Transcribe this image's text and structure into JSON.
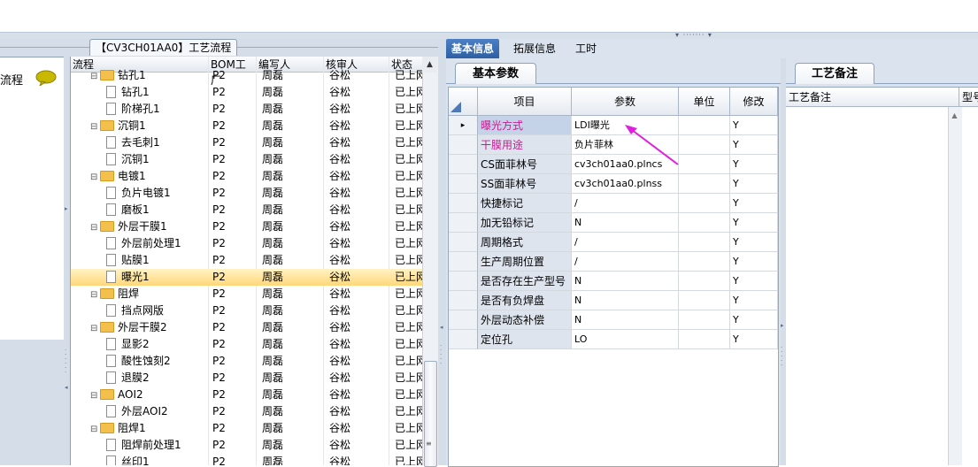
{
  "left_panel": {
    "flow_tab_label": "【CV3CH01AA0】工艺流程",
    "nav_label": "流程",
    "tree_headers": [
      "流程",
      "BOM工厂",
      "编写人",
      "核审人",
      "状态"
    ],
    "tree_rows": [
      {
        "level": 0,
        "kind": "folder",
        "name": "钻孔1",
        "bom": "P2",
        "author": "周磊",
        "reviewer": "谷松",
        "status": "已上网"
      },
      {
        "level": 1,
        "kind": "doc",
        "name": "钻孔1",
        "bom": "P2",
        "author": "周磊",
        "reviewer": "谷松",
        "status": "已上网"
      },
      {
        "level": 1,
        "kind": "doc",
        "name": "阶梯孔1",
        "bom": "P2",
        "author": "周磊",
        "reviewer": "谷松",
        "status": "已上网"
      },
      {
        "level": 0,
        "kind": "folder",
        "name": "沉铜1",
        "bom": "P2",
        "author": "周磊",
        "reviewer": "谷松",
        "status": "已上网"
      },
      {
        "level": 1,
        "kind": "doc",
        "name": "去毛刺1",
        "bom": "P2",
        "author": "周磊",
        "reviewer": "谷松",
        "status": "已上网"
      },
      {
        "level": 1,
        "kind": "doc",
        "name": "沉铜1",
        "bom": "P2",
        "author": "周磊",
        "reviewer": "谷松",
        "status": "已上网"
      },
      {
        "level": 0,
        "kind": "folder",
        "name": "电镀1",
        "bom": "P2",
        "author": "周磊",
        "reviewer": "谷松",
        "status": "已上网"
      },
      {
        "level": 1,
        "kind": "doc",
        "name": "负片电镀1",
        "bom": "P2",
        "author": "周磊",
        "reviewer": "谷松",
        "status": "已上网"
      },
      {
        "level": 1,
        "kind": "doc",
        "name": "磨板1",
        "bom": "P2",
        "author": "周磊",
        "reviewer": "谷松",
        "status": "已上网"
      },
      {
        "level": 0,
        "kind": "folder",
        "name": "外层干膜1",
        "bom": "P2",
        "author": "周磊",
        "reviewer": "谷松",
        "status": "已上网"
      },
      {
        "level": 1,
        "kind": "doc",
        "name": "外层前处理1",
        "bom": "P2",
        "author": "周磊",
        "reviewer": "谷松",
        "status": "已上网"
      },
      {
        "level": 1,
        "kind": "doc",
        "name": "贴膜1",
        "bom": "P2",
        "author": "周磊",
        "reviewer": "谷松",
        "status": "已上网"
      },
      {
        "level": 1,
        "kind": "doc",
        "name": "曝光1",
        "bom": "P2",
        "author": "周磊",
        "reviewer": "谷松",
        "status": "已上网",
        "selected": true
      },
      {
        "level": 0,
        "kind": "folder",
        "name": "阻焊",
        "bom": "P2",
        "author": "周磊",
        "reviewer": "谷松",
        "status": "已上网"
      },
      {
        "level": 1,
        "kind": "doc",
        "name": "挡点网版",
        "bom": "P2",
        "author": "周磊",
        "reviewer": "谷松",
        "status": "已上网"
      },
      {
        "level": 0,
        "kind": "folder",
        "name": "外层干膜2",
        "bom": "P2",
        "author": "周磊",
        "reviewer": "谷松",
        "status": "已上网"
      },
      {
        "level": 1,
        "kind": "doc",
        "name": "显影2",
        "bom": "P2",
        "author": "周磊",
        "reviewer": "谷松",
        "status": "已上网"
      },
      {
        "level": 1,
        "kind": "doc",
        "name": "酸性蚀刻2",
        "bom": "P2",
        "author": "周磊",
        "reviewer": "谷松",
        "status": "已上网"
      },
      {
        "level": 1,
        "kind": "doc",
        "name": "退膜2",
        "bom": "P2",
        "author": "周磊",
        "reviewer": "谷松",
        "status": "已上网"
      },
      {
        "level": 0,
        "kind": "folder",
        "name": "AOI2",
        "bom": "P2",
        "author": "周磊",
        "reviewer": "谷松",
        "status": "已上网"
      },
      {
        "level": 1,
        "kind": "doc",
        "name": "外层AOI2",
        "bom": "P2",
        "author": "周磊",
        "reviewer": "谷松",
        "status": "已上网"
      },
      {
        "level": 0,
        "kind": "folder",
        "name": "阻焊1",
        "bom": "P2",
        "author": "周磊",
        "reviewer": "谷松",
        "status": "已上网"
      },
      {
        "level": 1,
        "kind": "doc",
        "name": "阻焊前处理1",
        "bom": "P2",
        "author": "周磊",
        "reviewer": "谷松",
        "status": "已上网"
      },
      {
        "level": 1,
        "kind": "doc",
        "name": "丝印1",
        "bom": "P2",
        "author": "周磊",
        "reviewer": "谷松",
        "status": "已上网"
      }
    ]
  },
  "right_panel": {
    "tabs": [
      "基本信息",
      "拓展信息",
      "工时"
    ],
    "params_tab": "基本参数",
    "grid_headers": [
      "项目",
      "参数",
      "单位",
      "修改"
    ],
    "rows": [
      {
        "item": "曝光方式",
        "value": "LDI曝光",
        "unit": "",
        "modify": "Y",
        "pink": true,
        "current": true
      },
      {
        "item": "干膜用途",
        "value": "负片菲林",
        "unit": "",
        "modify": "Y",
        "pink": true
      },
      {
        "item": "CS面菲林号",
        "value": "cv3ch01aa0.plncs",
        "unit": "",
        "modify": "Y"
      },
      {
        "item": "SS面菲林号",
        "value": "cv3ch01aa0.plnss",
        "unit": "",
        "modify": "Y"
      },
      {
        "item": "快捷标记",
        "value": "/",
        "unit": "",
        "modify": "Y"
      },
      {
        "item": "加无铅标记",
        "value": "N",
        "unit": "",
        "modify": "Y"
      },
      {
        "item": "周期格式",
        "value": "/",
        "unit": "",
        "modify": "Y"
      },
      {
        "item": "生产周期位置",
        "value": "/",
        "unit": "",
        "modify": "Y"
      },
      {
        "item": "是否存在生产型号",
        "value": "N",
        "unit": "",
        "modify": "Y"
      },
      {
        "item": "是否有负焊盘",
        "value": "N",
        "unit": "",
        "modify": "Y"
      },
      {
        "item": "外层动态补偿",
        "value": "N",
        "unit": "",
        "modify": "Y"
      },
      {
        "item": "定位孔",
        "value": "LO",
        "unit": "",
        "modify": "Y"
      }
    ],
    "notes_tab": "工艺备注",
    "notes_header": "工艺备注",
    "type_header": "型号"
  },
  "colors": {
    "accent": "#2d5fa6",
    "pink_text": "#c0208f",
    "arrow": "#e020e0",
    "selected_row": "#ffd77a"
  },
  "icons": {
    "chat": "speech-bubble-icon",
    "folder": "folder-icon",
    "doc": "document-icon",
    "arrow": "annotation-arrow-icon"
  }
}
